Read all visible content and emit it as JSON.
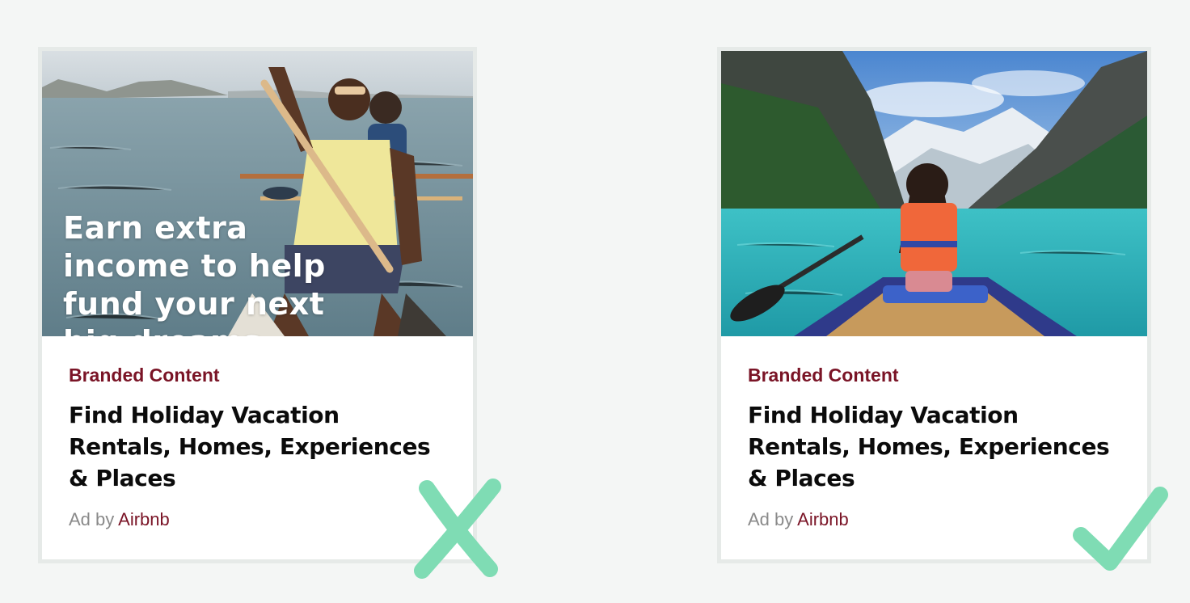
{
  "colors": {
    "background": "#f4f6f5",
    "card_border": "#e6eae8",
    "category_color": "#7a1426",
    "advertiser_color": "#7a1426",
    "mark_color": "#7fdcb4"
  },
  "cards": [
    {
      "image_overlay_lines": [
        "Earn extra",
        "income to help",
        "fund your next",
        "big dreams"
      ],
      "category": "Branded Content",
      "headline_lines": [
        "Find Holiday Vacation",
        "Rentals, Homes, Experiences",
        "& Places"
      ],
      "byline_prefix": "Ad by",
      "advertiser": "Airbnb",
      "verdict_icon": "x-mark-icon"
    },
    {
      "category": "Branded Content",
      "headline_lines": [
        "Find Holiday Vacation",
        "Rentals, Homes, Experiences",
        "& Places"
      ],
      "byline_prefix": "Ad by",
      "advertiser": "Airbnb",
      "verdict_icon": "check-mark-icon"
    }
  ]
}
